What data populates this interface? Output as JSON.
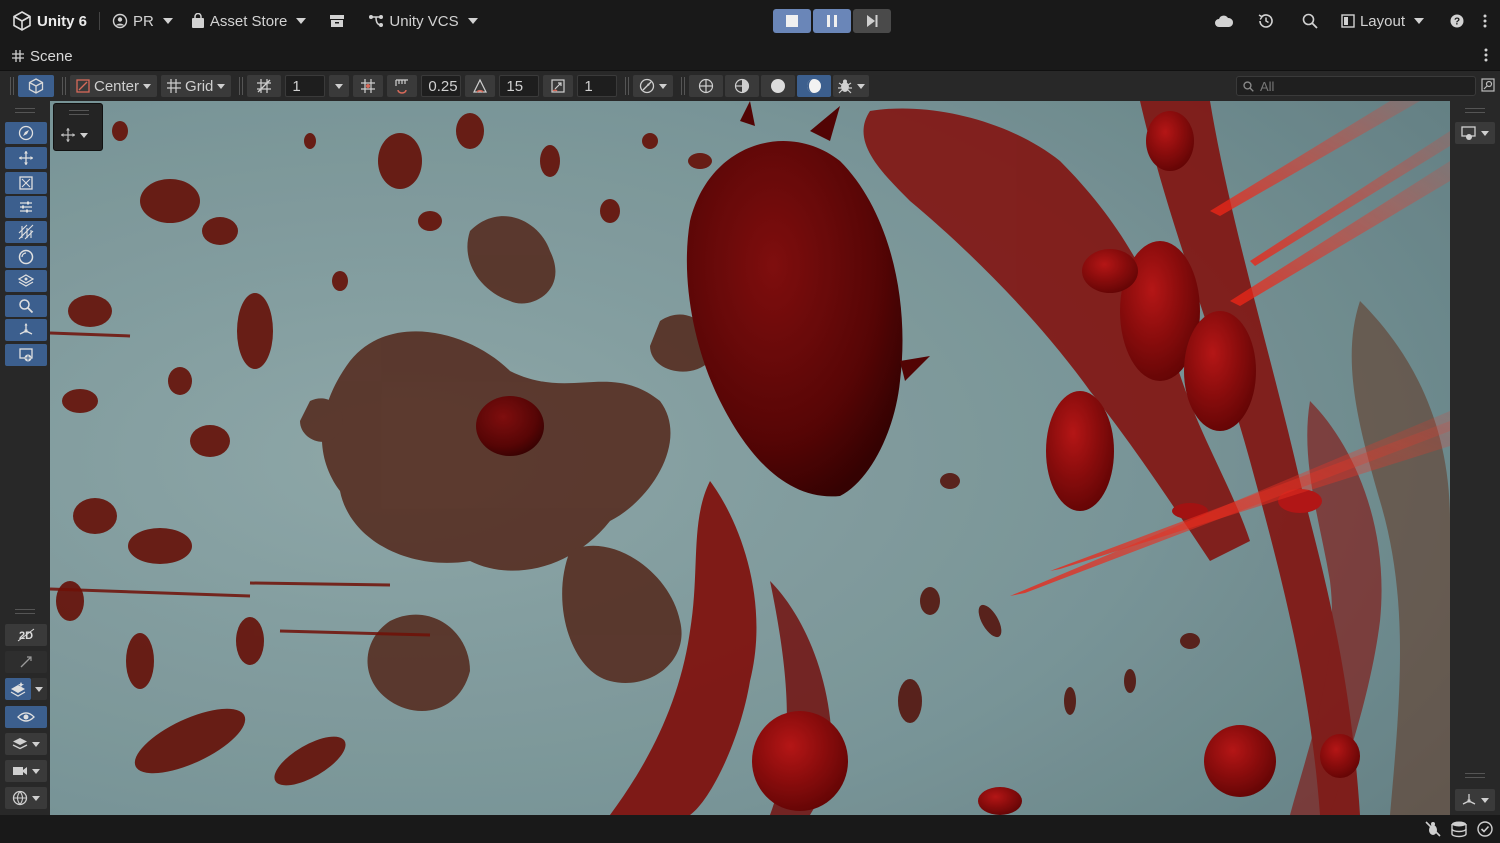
{
  "topbar": {
    "logo_label": "Unity 6",
    "account_label": "PR",
    "asset_store_label": "Asset Store",
    "vcs_label": "Unity VCS",
    "layout_label": "Layout"
  },
  "tab": {
    "title": "Scene"
  },
  "scene_toolbar": {
    "pivot_label": "Center",
    "grid_label": "Grid",
    "grid_size_value": "1",
    "move_snap_value": "0.25",
    "rotate_snap_value": "15",
    "scale_snap_value": "1",
    "search_placeholder": "All"
  },
  "colors": {
    "accent": "#3c5f8e",
    "play_active": "#6a86b8",
    "panel": "#282828",
    "background": "#191919"
  }
}
